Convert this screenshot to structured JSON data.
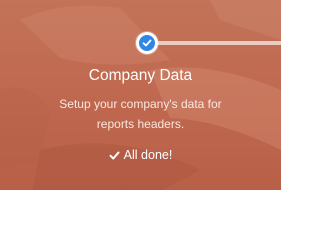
{
  "colors": {
    "card_background": "#c06a51",
    "step_active": "#2f86e6",
    "text": "#ffffff"
  },
  "step": {
    "icon": "check-icon",
    "state": "completed"
  },
  "card": {
    "title": "Company Data",
    "description": "Setup your company's data for reports headers.",
    "status_icon": "check-icon",
    "status_text": "All done!"
  }
}
